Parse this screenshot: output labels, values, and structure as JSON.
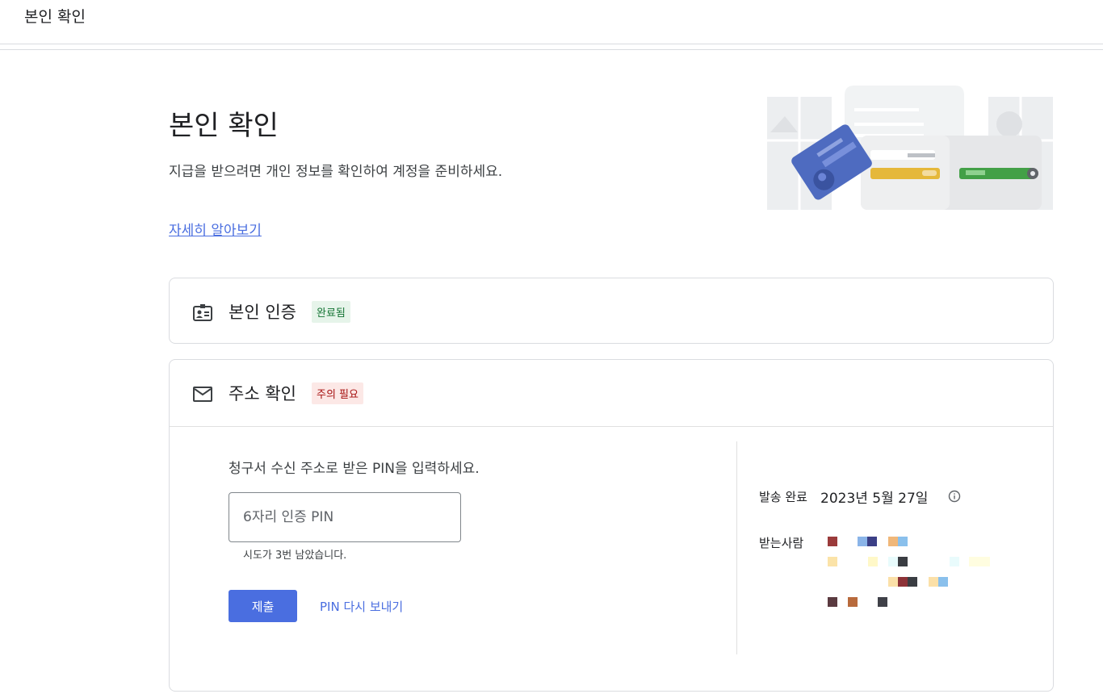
{
  "topbar": {
    "title": "본인 확인"
  },
  "hero": {
    "title": "본인 확인",
    "description": "지급을 받으려면 개인 정보를 확인하여 계정을 준비하세요.",
    "learn_more": "자세히 알아보기"
  },
  "identity_card": {
    "title": "본인 인증",
    "icon": "id-badge-icon",
    "status": "완료됨",
    "status_color": "#137333"
  },
  "address_card": {
    "title": "주소 확인",
    "icon": "mail-envelope-icon",
    "status": "주의 필요",
    "status_color": "#a50e0e",
    "prompt": "청구서 수신 주소로 받은 PIN을 입력하세요.",
    "pin_placeholder": "6자리 인증 PIN",
    "attempts_text": "시도가 3번 남았습니다.",
    "submit_label": "제출",
    "resend_label": "PIN 다시 보내기",
    "sent_label": "발송 완료",
    "sent_date": "2023년 5월 27일",
    "recipient_label": "받는사람"
  },
  "colors": {
    "accent": "#4a6ee0",
    "border": "#dadce0"
  }
}
